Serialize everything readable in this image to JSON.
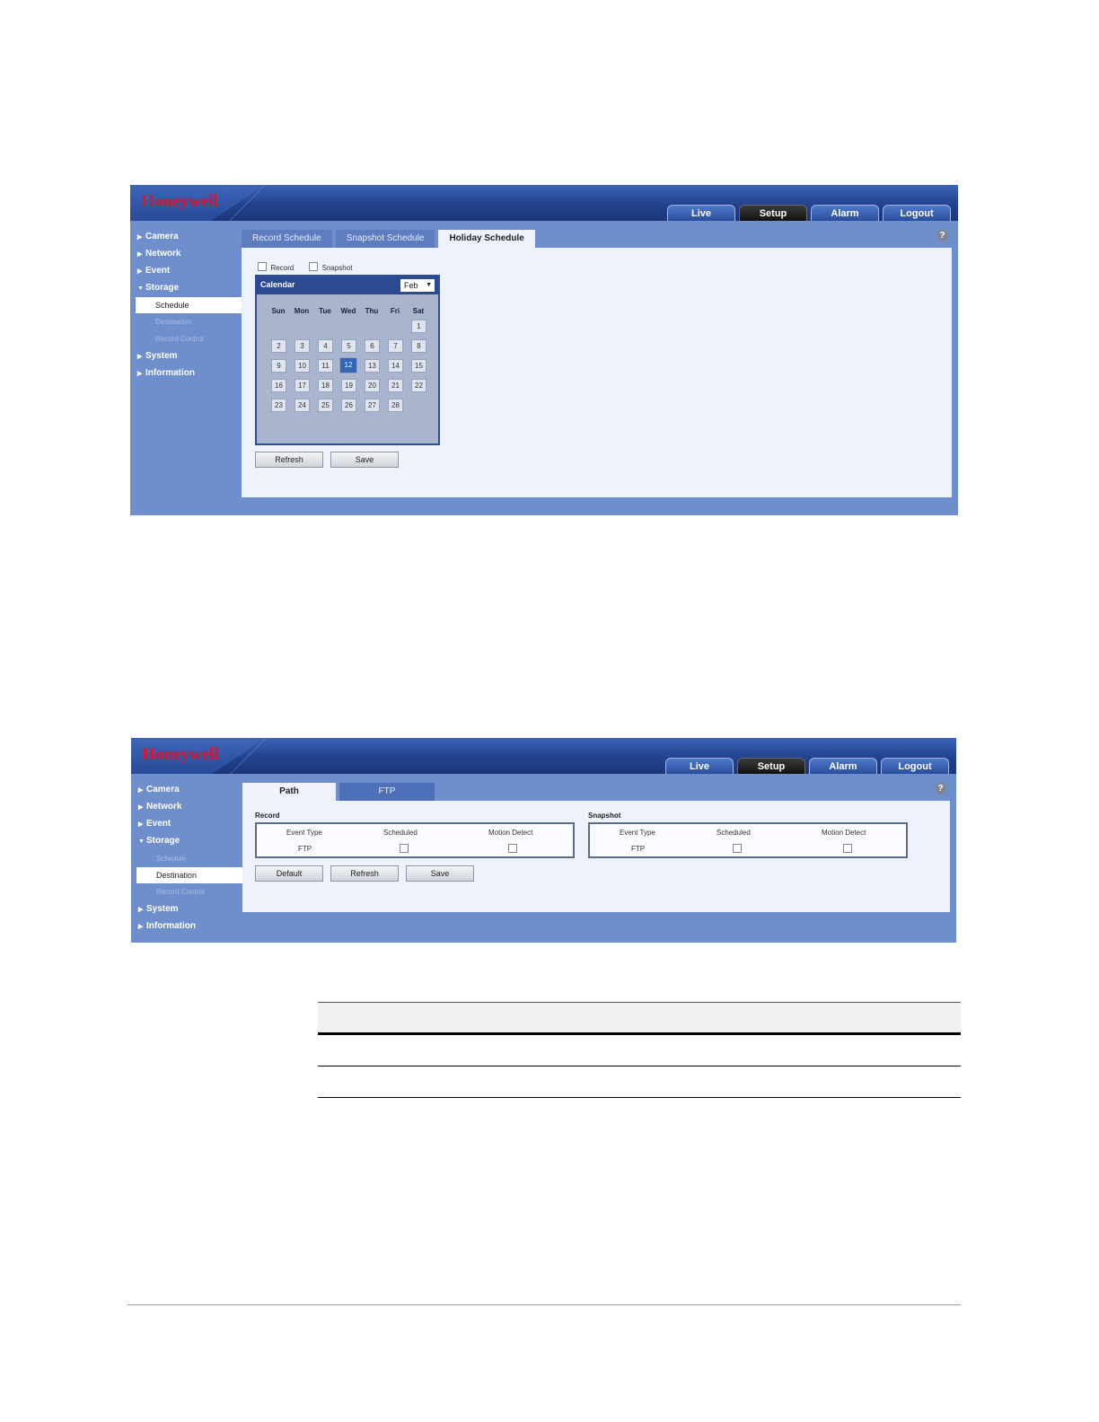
{
  "brand": "Honeywell",
  "colors": {
    "header": "#23428f",
    "brand_red": "#d8142a",
    "body": "#6f8fcc",
    "panel": "#eef3fb",
    "selected_day": "#3466b8"
  },
  "topnav": [
    "Live",
    "Setup",
    "Alarm",
    "Logout"
  ],
  "sidebar": {
    "camera": "Camera",
    "network": "Network",
    "event": "Event",
    "storage": "Storage",
    "sub": [
      "Schedule",
      "Destination",
      "Record Control"
    ],
    "system": "System",
    "information": "Information"
  },
  "screen1": {
    "tabs": [
      "Record Schedule",
      "Snapshot Schedule",
      "Holiday Schedule"
    ],
    "record_label": "Record",
    "snapshot_label": "Snapshot",
    "calendar_title": "Calendar",
    "month": "Feb",
    "weekdays": [
      "Sun",
      "Mon",
      "Tue",
      "Wed",
      "Thu",
      "Fri",
      "Sat"
    ],
    "selected_day": "12",
    "buttons": {
      "refresh": "Refresh",
      "save": "Save"
    }
  },
  "screen2": {
    "tabs": [
      "Path",
      "FTP"
    ],
    "record": {
      "title": "Record",
      "cols": [
        "Event Type",
        "Scheduled",
        "Motion Detect"
      ],
      "row": "FTP"
    },
    "snapshot": {
      "title": "Snapshot",
      "cols": [
        "Event Type",
        "Scheduled",
        "Motion Detect"
      ],
      "row": "FTP"
    },
    "buttons": {
      "default": "Default",
      "refresh": "Refresh",
      "save": "Save"
    }
  },
  "help_glyph": "?"
}
